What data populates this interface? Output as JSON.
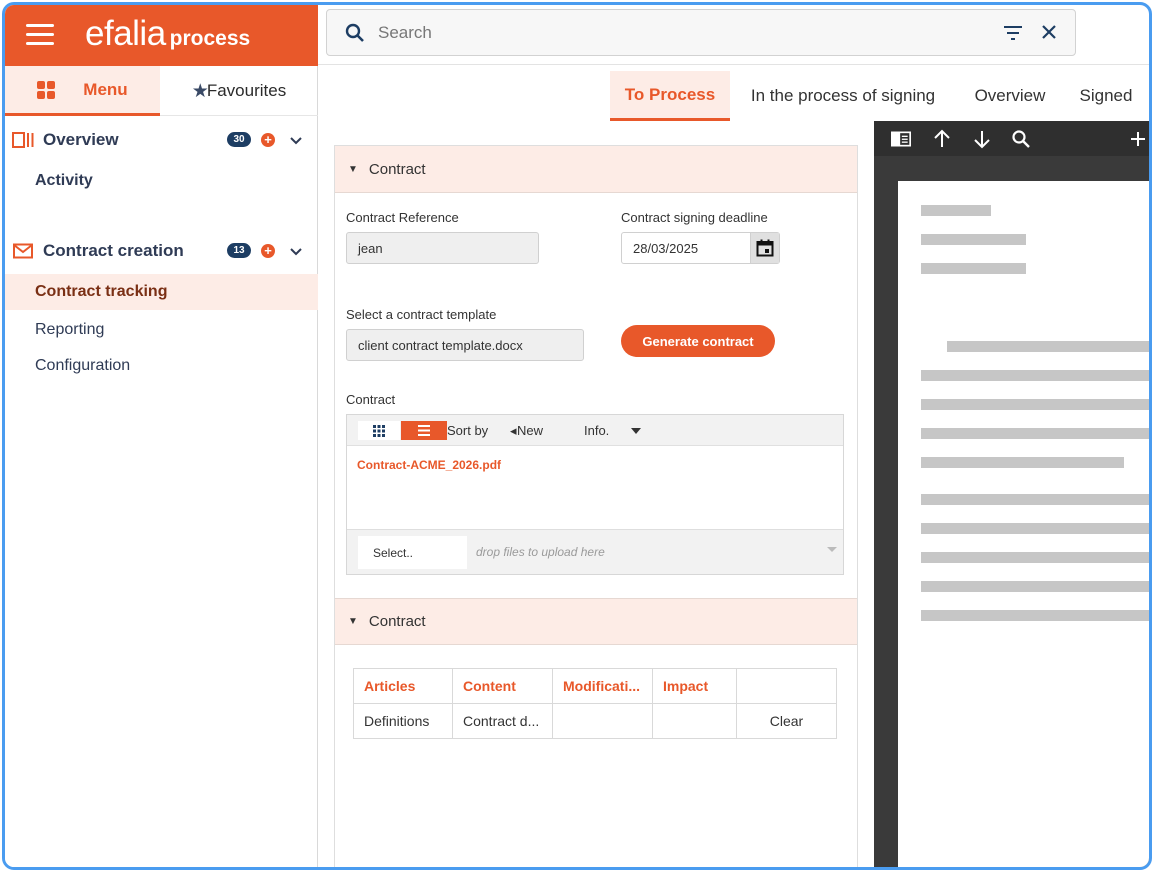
{
  "brand": {
    "name": "efalia",
    "suffix": "process"
  },
  "sidebar": {
    "tabs": [
      {
        "label": "Menu"
      },
      {
        "label": "Favourites"
      }
    ],
    "sections": [
      {
        "title": "Overview",
        "count": "30",
        "items": [
          {
            "label": "Activity"
          }
        ]
      },
      {
        "title": "Contract creation",
        "count": "13",
        "items": [
          {
            "label": "Contract tracking"
          },
          {
            "label": "Reporting"
          },
          {
            "label": "Configuration"
          }
        ]
      }
    ]
  },
  "search": {
    "placeholder": "Search"
  },
  "main_tabs": [
    {
      "label": "To Process",
      "active": true
    },
    {
      "label": "In the process of signing"
    },
    {
      "label": "Overview"
    },
    {
      "label": "Signed"
    }
  ],
  "form": {
    "section1_title": "Contract",
    "contract_reference": {
      "label": "Contract Reference",
      "value": "jean"
    },
    "deadline": {
      "label": "Contract signing deadline",
      "value": "28/03/2025"
    },
    "template": {
      "label": "Select a contract template",
      "value": "client contract template.docx"
    },
    "generate_label": "Generate contract",
    "contract_files": {
      "label": "Contract",
      "sort_by": "Sort by",
      "sort_new": "New",
      "sort_info": "Info.",
      "files": [
        "Contract-ACME_2026.pdf"
      ],
      "select_label": "Select..",
      "drop_text": "drop files to upload here"
    },
    "section2_title": "Contract",
    "table": {
      "headers": [
        "Articles",
        "Content",
        "Modificati...",
        "Impact",
        ""
      ],
      "rows": [
        [
          "Definitions",
          "Contract d...",
          "",
          "",
          "Clear"
        ]
      ]
    }
  },
  "colors": {
    "accent": "#e8582a",
    "accent_light": "#fdece6",
    "navy": "#1d3d63",
    "frame": "#4a9cf0"
  }
}
